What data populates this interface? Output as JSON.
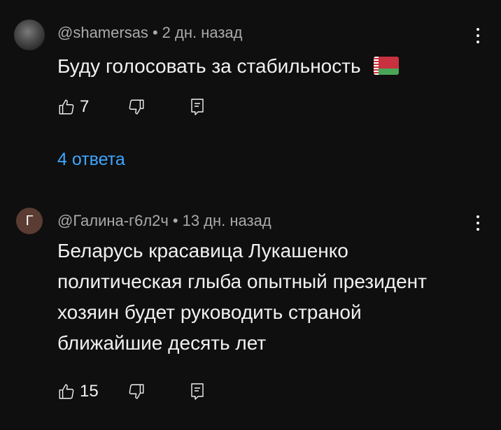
{
  "comments": [
    {
      "author": "@shamersas",
      "separator": "•",
      "time": "2 дн. назад",
      "text": "Буду голосовать за стабильность",
      "flag_icon": "belarus-flag",
      "likes": "7",
      "replies_label": "4 ответа"
    },
    {
      "author": "@Галина-г6л2ч",
      "avatar_letter": "Г",
      "separator": "•",
      "time": "13 дн. назад",
      "text": "Беларусь красавица Лукашенко политическая глыба опытный президент хозяин будет руководить страной ближайшие десять лет",
      "likes": "15"
    }
  ],
  "colors": {
    "background": "#0f0f0f",
    "text_primary": "#f1f1f1",
    "text_secondary": "#aaaaaa",
    "link": "#3ea6ff",
    "avatar_letter_bg": "#5b3c33"
  },
  "icons": {
    "like": "thumbs-up-icon",
    "dislike": "thumbs-down-icon",
    "reply": "reply-icon",
    "more": "more-vertical-icon"
  }
}
